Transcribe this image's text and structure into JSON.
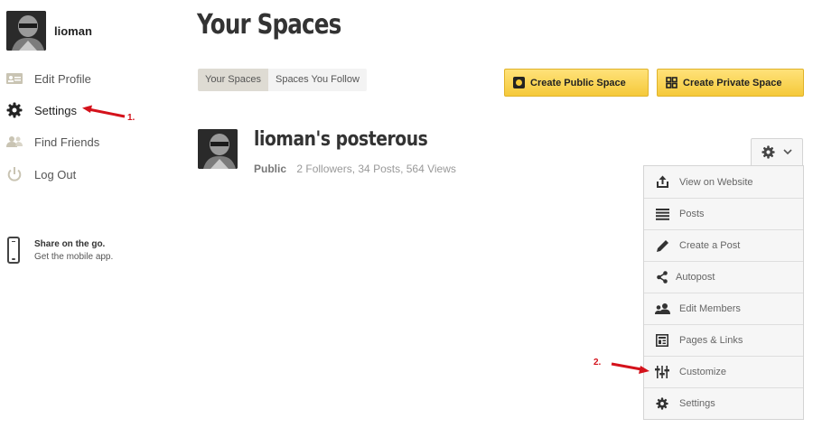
{
  "user": {
    "name": "lioman"
  },
  "sidebar": {
    "items": [
      {
        "label": "Edit Profile",
        "icon": "id-card-icon"
      },
      {
        "label": "Settings",
        "icon": "gear-icon"
      },
      {
        "label": "Find Friends",
        "icon": "people-icon"
      },
      {
        "label": "Log Out",
        "icon": "power-icon"
      }
    ],
    "mobile": {
      "title": "Share on the go.",
      "subtitle": "Get the mobile app."
    }
  },
  "main": {
    "title": "Your Spaces",
    "tabs": [
      {
        "label": "Your Spaces",
        "active": true
      },
      {
        "label": "Spaces You Follow",
        "active": false
      }
    ],
    "buttons": {
      "create_public": "Create Public Space",
      "create_private": "Create Private Space"
    },
    "space": {
      "title": "lioman's posterous",
      "visibility": "Public",
      "stats": "2 Followers,  34 Posts,  564 Views"
    },
    "menu": {
      "items": [
        {
          "label": "View on Website",
          "icon": "share-out-icon"
        },
        {
          "label": "Posts",
          "icon": "list-icon"
        },
        {
          "label": "Create a Post",
          "icon": "pencil-icon"
        },
        {
          "label": "Autopost",
          "icon": "share-nodes-icon"
        },
        {
          "label": "Edit Members",
          "icon": "members-icon"
        },
        {
          "label": "Pages & Links",
          "icon": "pages-icon"
        },
        {
          "label": "Customize",
          "icon": "sliders-icon"
        },
        {
          "label": "Settings",
          "icon": "gear-icon"
        }
      ]
    }
  },
  "annotations": {
    "first": "1.",
    "second": "2."
  },
  "colors": {
    "accent_yellow": "#f5c93a",
    "annotation_red": "#d4121b"
  }
}
